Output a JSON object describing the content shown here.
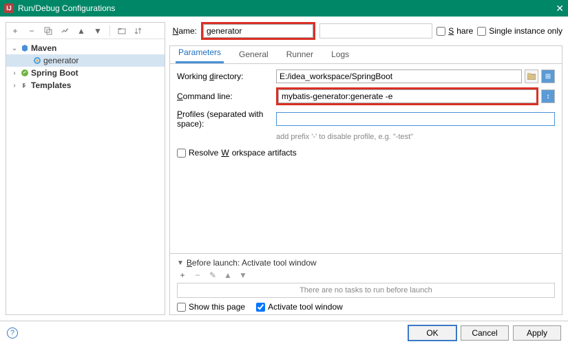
{
  "window": {
    "title": "Run/Debug Configurations"
  },
  "toolbar": {},
  "tree": {
    "items": [
      {
        "label": "Maven",
        "bold": true,
        "expanded": true,
        "iconClass": "maven",
        "indent": 0
      },
      {
        "label": "generator",
        "bold": false,
        "selected": true,
        "iconClass": "mvn2",
        "indent": 1
      },
      {
        "label": "Spring Boot",
        "bold": true,
        "expanded": false,
        "iconClass": "spring",
        "indent": 0
      },
      {
        "label": "Templates",
        "bold": true,
        "expanded": false,
        "iconClass": "template",
        "indent": 0
      }
    ]
  },
  "name": {
    "label": "Name:",
    "value": "generator"
  },
  "share": {
    "label": "Share",
    "checked": false
  },
  "singleInstance": {
    "label": "Single instance only",
    "checked": false
  },
  "tabs": [
    "Parameters",
    "General",
    "Runner",
    "Logs"
  ],
  "activeTab": 0,
  "form": {
    "workingDir": {
      "label": "Working directory:",
      "value": "E:/idea_workspace/SpringBoot"
    },
    "commandLine": {
      "label": "Command line:",
      "value": "mybatis-generator:generate -e"
    },
    "profiles": {
      "label": "Profiles (separated with space):",
      "value": "",
      "hint": "add prefix '-' to disable profile, e.g. \"-test\""
    },
    "resolveWs": {
      "label": "Resolve Workspace artifacts",
      "checked": false
    }
  },
  "beforeLaunch": {
    "header": "Before launch: Activate tool window",
    "emptyText": "There are no tasks to run before launch",
    "showPage": {
      "label": "Show this page",
      "checked": false
    },
    "activateTool": {
      "label": "Activate tool window",
      "checked": true
    }
  },
  "buttons": {
    "ok": "OK",
    "cancel": "Cancel",
    "apply": "Apply"
  }
}
